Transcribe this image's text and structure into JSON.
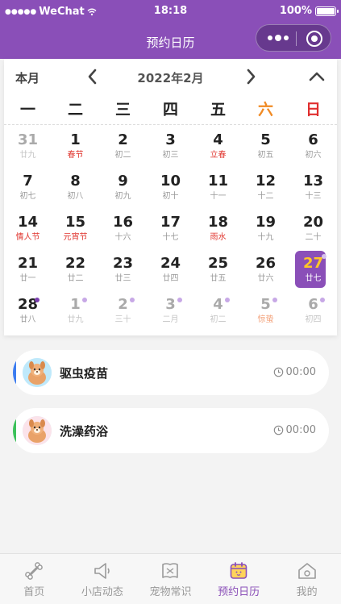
{
  "status": {
    "carrier": "WeChat",
    "time": "18:18",
    "battery": "100%",
    "battery_level": 1.0
  },
  "nav": {
    "title": "预约日历"
  },
  "calendar": {
    "view_toggle": "本月",
    "title": "2022年2月",
    "weekdays": [
      "一",
      "二",
      "三",
      "四",
      "五",
      "六",
      "日"
    ],
    "weeks": [
      [
        {
          "day": "31",
          "lunar": "廿九",
          "muted": true
        },
        {
          "day": "1",
          "lunar": "春节",
          "festival": true
        },
        {
          "day": "2",
          "lunar": "初二"
        },
        {
          "day": "3",
          "lunar": "初三"
        },
        {
          "day": "4",
          "lunar": "立春",
          "festival": true
        },
        {
          "day": "5",
          "lunar": "初五"
        },
        {
          "day": "6",
          "lunar": "初六"
        }
      ],
      [
        {
          "day": "7",
          "lunar": "初七"
        },
        {
          "day": "8",
          "lunar": "初八"
        },
        {
          "day": "9",
          "lunar": "初九"
        },
        {
          "day": "10",
          "lunar": "初十"
        },
        {
          "day": "11",
          "lunar": "十一"
        },
        {
          "day": "12",
          "lunar": "十二"
        },
        {
          "day": "13",
          "lunar": "十三"
        }
      ],
      [
        {
          "day": "14",
          "lunar": "情人节",
          "festival": true
        },
        {
          "day": "15",
          "lunar": "元宵节",
          "festival": true
        },
        {
          "day": "16",
          "lunar": "十六"
        },
        {
          "day": "17",
          "lunar": "十七"
        },
        {
          "day": "18",
          "lunar": "雨水",
          "festival": true
        },
        {
          "day": "19",
          "lunar": "十九"
        },
        {
          "day": "20",
          "lunar": "二十"
        }
      ],
      [
        {
          "day": "21",
          "lunar": "廿一"
        },
        {
          "day": "22",
          "lunar": "廿二"
        },
        {
          "day": "23",
          "lunar": "廿三"
        },
        {
          "day": "24",
          "lunar": "廿四"
        },
        {
          "day": "25",
          "lunar": "廿五"
        },
        {
          "day": "26",
          "lunar": "廿六"
        },
        {
          "day": "27",
          "lunar": "廿七",
          "selected": true,
          "dot": true
        }
      ],
      [
        {
          "day": "28",
          "lunar": "廿八",
          "dot": true,
          "dot_dark": true
        },
        {
          "day": "1",
          "lunar": "廿九",
          "muted": true,
          "dot": true
        },
        {
          "day": "2",
          "lunar": "三十",
          "muted": true,
          "dot": true
        },
        {
          "day": "3",
          "lunar": "二月",
          "muted": true,
          "dot": true
        },
        {
          "day": "4",
          "lunar": "初二",
          "muted": true,
          "dot": true
        },
        {
          "day": "5",
          "lunar": "惊蛰",
          "muted": true,
          "festival": true,
          "dot": true
        },
        {
          "day": "6",
          "lunar": "初四",
          "muted": true,
          "dot": true
        }
      ]
    ]
  },
  "appointments": [
    {
      "title": "驱虫疫苗",
      "time": "00:00",
      "color": "#3b7cf0"
    },
    {
      "title": "洗澡药浴",
      "time": "00:00",
      "color": "#3cc15a"
    }
  ],
  "tabbar": {
    "items": [
      {
        "label": "首页",
        "icon": "bone-icon"
      },
      {
        "label": "小店动态",
        "icon": "megaphone-icon"
      },
      {
        "label": "宠物常识",
        "icon": "book-icon"
      },
      {
        "label": "预约日历",
        "icon": "calendar-icon"
      },
      {
        "label": "我的",
        "icon": "house-icon"
      }
    ],
    "active_index": 3
  },
  "colors": {
    "primary": "#8a4fb8",
    "selected_day": "#ffc726",
    "festival": "#e0362f",
    "saturday": "#f08a24",
    "sunday": "#e02f2f"
  }
}
